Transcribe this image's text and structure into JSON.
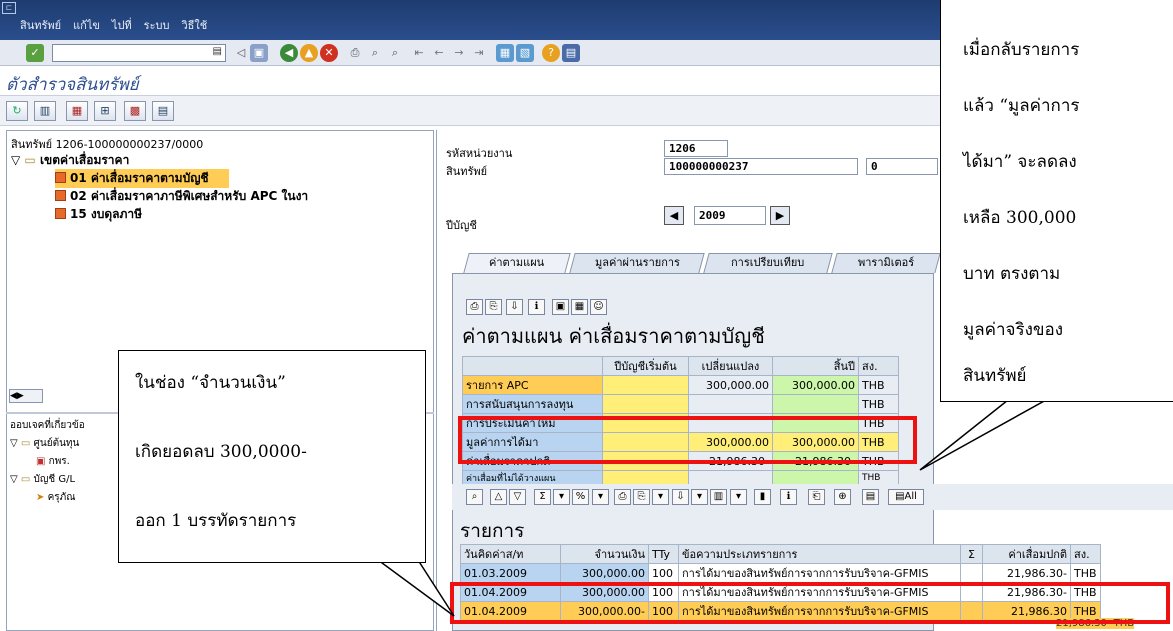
{
  "menu": {
    "items": [
      "สินทรัพย์",
      "แก้ไข",
      "ไปที่",
      "ระบบ",
      "วิธีใช้"
    ]
  },
  "screen_title": "ตัวสำรวจสินทรัพย์",
  "tree": {
    "header": "สินทรัพย์ 1206-100000000237/0000",
    "folder": "เขตค่าเสื่อมราคา",
    "items": [
      "01 ค่าเสื่อมราคาตามบัญชี",
      "02 ค่าเสื่อมราคาภาษีพิเศษสำหรับ APC ในงา",
      "15 งบดุลภาษี"
    ]
  },
  "lower_tree": {
    "header": "ออบเจคที่เกี่ยวข้อ",
    "items": [
      "ศูนย์ต้นทุน",
      "กพร.",
      "บัญชี G/L",
      "ครุภัณ"
    ]
  },
  "fields": {
    "company_label": "รหัสหน่วยงาน",
    "company_value": "1206",
    "asset_label": "สินทรัพย์",
    "asset_value": "100000000237",
    "asset_sub": "0",
    "year_label": "ปีบัญชี",
    "year_value": "2009"
  },
  "tabs": [
    "ค่าตามแผน",
    "มูลค่าผ่านรายการ",
    "การเปรียบเทียบ",
    "พารามิเตอร์"
  ],
  "plan": {
    "title": "ค่าตามแผน ค่าเสื่อมราคาตามบัญชี",
    "headers": [
      "",
      "ปีบัญชีเริ่มต้น",
      "เปลี่ยนแปลง",
      "สิ้นปี",
      "สง."
    ],
    "rows": [
      [
        "รายการ APC",
        "",
        "300,000.00",
        "300,000.00",
        "THB"
      ],
      [
        "การสนับสนุนการลงทุน",
        "",
        "",
        "",
        "THB"
      ],
      [
        "การประเมินค่าใหม่",
        "",
        "",
        "",
        "THB"
      ],
      [
        "มูลค่าการได้มา",
        "",
        "300,000.00",
        "300,000.00",
        "THB"
      ],
      [
        "ค่าเสื่อมราคาปกติ",
        "",
        "21,986.30-",
        "21,986.30-",
        "THB"
      ],
      [
        "ค่าเสื่อมที่ไม่ได้วางแผน",
        "",
        "",
        "",
        "THB"
      ]
    ]
  },
  "items_section": {
    "title": "รายการ",
    "headers": [
      "วันคิดค่าส/ท",
      "จำนวนเงิน",
      "TTy",
      "ข้อความประเภทรายการ",
      "Σ",
      "ค่าเสื่อมปกติ",
      "สง."
    ],
    "rows": [
      [
        "01.03.2009",
        "300,000.00",
        "100",
        "การได้มาของสินทรัพย์การจากการรับบริจาค-GFMIS",
        "",
        "21,986.30-",
        "THB"
      ],
      [
        "01.04.2009",
        "300,000.00",
        "100",
        "การได้มาของสินทรัพย์การจากการรับบริจาค-GFMIS",
        "",
        "21,986.30-",
        "THB"
      ],
      [
        "01.04.2009",
        "300,000.00-",
        "100",
        "การได้มาของสินทรัพย์การจากการรับบริจาค-GFMIS",
        "",
        "21,986.30",
        "THB"
      ]
    ],
    "footer_total": "21,986.30- THB"
  },
  "callout_left": {
    "lines": [
      "ในช่อง “จำนวนเงิน”",
      "เกิดยอดลบ 300,0000-",
      "ออก 1 บรรทัดรายการ"
    ]
  },
  "callout_right": {
    "lines": [
      "เมื่อกลับรายการ",
      "แล้ว “มูลค่าการ",
      "ได้มา” จะลดลง",
      "เหลือ 300,000",
      "บาท ตรงตาม",
      "มูลค่าจริงของ",
      "สินทรัพย์"
    ]
  },
  "colors": {
    "accent": "#2e4f8f",
    "highlight": "#ffcc55",
    "alert_box": "#ee1111"
  }
}
